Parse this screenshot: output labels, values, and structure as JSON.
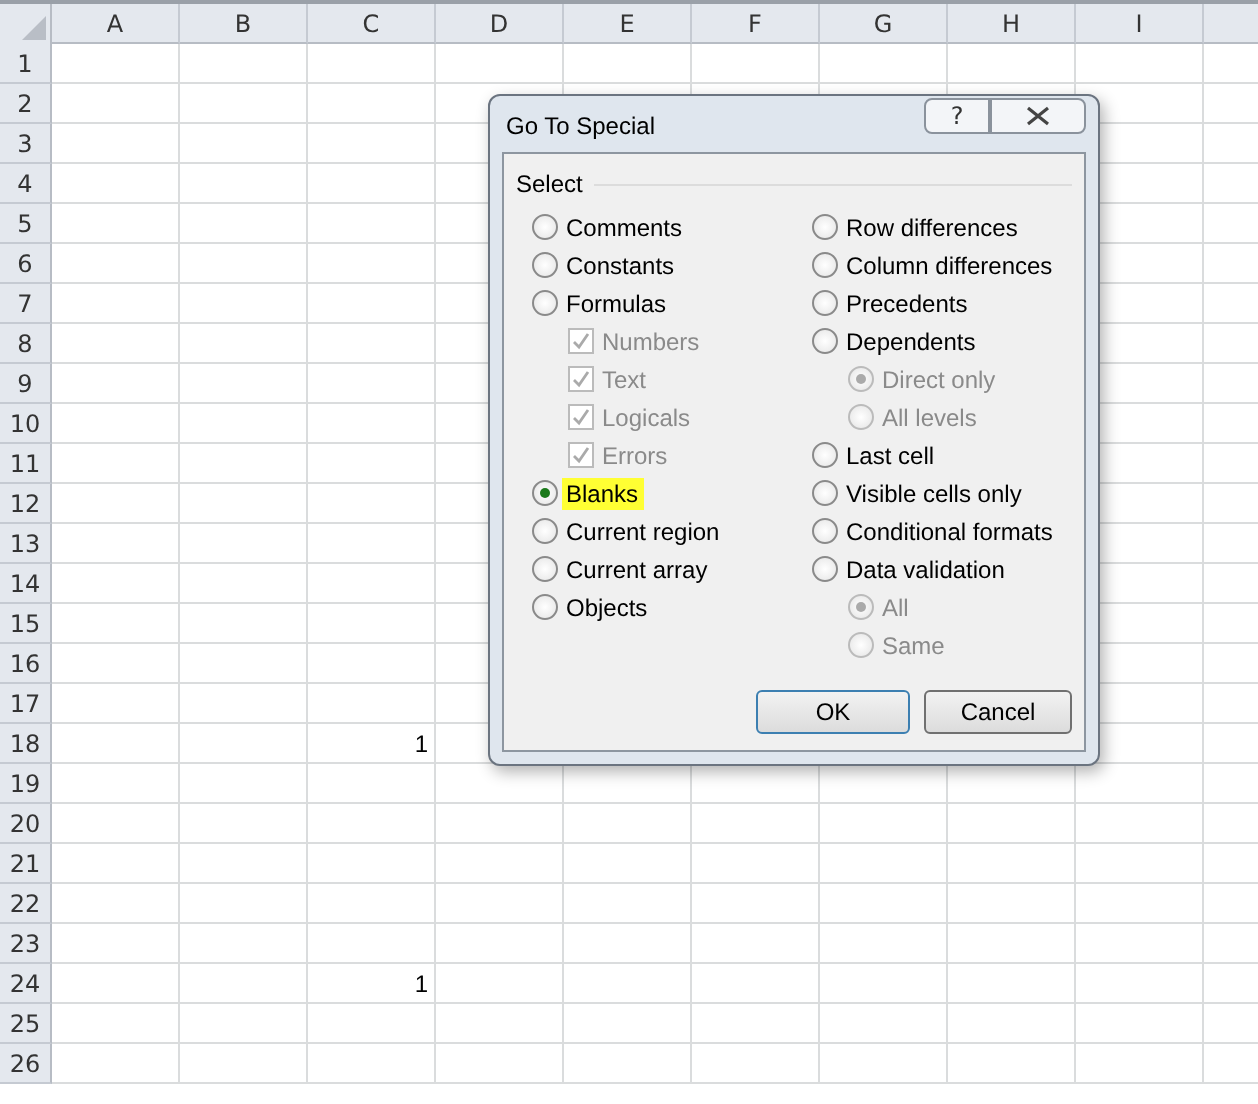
{
  "sheet": {
    "columns": [
      "A",
      "B",
      "C",
      "D",
      "E",
      "F",
      "G",
      "H",
      "I"
    ],
    "rows": [
      {
        "header": "1"
      },
      {
        "header": "2"
      },
      {
        "header": "3"
      },
      {
        "header": "4"
      },
      {
        "header": "5"
      },
      {
        "header": "6"
      },
      {
        "header": "7"
      },
      {
        "header": "8"
      },
      {
        "header": "9"
      },
      {
        "header": "10"
      },
      {
        "header": "11"
      },
      {
        "header": "12"
      },
      {
        "header": "13"
      },
      {
        "header": "14"
      },
      {
        "header": "15"
      },
      {
        "header": "16"
      },
      {
        "header": "17"
      },
      {
        "header": "18",
        "column_c": "1"
      },
      {
        "header": "19"
      },
      {
        "header": "20"
      },
      {
        "header": "21"
      },
      {
        "header": "22"
      },
      {
        "header": "23"
      },
      {
        "header": "24",
        "column_c": "1"
      },
      {
        "header": "25"
      },
      {
        "header": "26"
      }
    ]
  },
  "dialog": {
    "title": "Go To Special",
    "help": "?",
    "group_label": "Select",
    "left_options": [
      {
        "kind": "radio",
        "label": "Comments",
        "selected": false
      },
      {
        "kind": "radio",
        "label": "Constants",
        "selected": false
      },
      {
        "kind": "radio",
        "label": "Formulas",
        "selected": false,
        "children": [
          {
            "kind": "checkbox",
            "label": "Numbers",
            "checked": true,
            "disabled": true
          },
          {
            "kind": "checkbox",
            "label": "Text",
            "checked": true,
            "disabled": true
          },
          {
            "kind": "checkbox",
            "label": "Logicals",
            "checked": true,
            "disabled": true
          },
          {
            "kind": "checkbox",
            "label": "Errors",
            "checked": true,
            "disabled": true
          }
        ]
      },
      {
        "kind": "radio",
        "label": "Blanks",
        "selected": true,
        "highlighted": true
      },
      {
        "kind": "radio",
        "label": "Current region",
        "selected": false
      },
      {
        "kind": "radio",
        "label": "Current array",
        "selected": false
      },
      {
        "kind": "radio",
        "label": "Objects",
        "selected": false
      }
    ],
    "right_options": [
      {
        "kind": "radio",
        "label": "Row differences",
        "selected": false
      },
      {
        "kind": "radio",
        "label": "Column differences",
        "selected": false
      },
      {
        "kind": "radio",
        "label": "Precedents",
        "selected": false
      },
      {
        "kind": "radio",
        "label": "Dependents",
        "selected": false,
        "children": [
          {
            "kind": "radio",
            "label": "Direct only",
            "selected": true,
            "disabled": true
          },
          {
            "kind": "radio",
            "label": "All levels",
            "selected": false,
            "disabled": true
          }
        ]
      },
      {
        "kind": "radio",
        "label": "Last cell",
        "selected": false
      },
      {
        "kind": "radio",
        "label": "Visible cells only",
        "selected": false
      },
      {
        "kind": "radio",
        "label": "Conditional formats",
        "selected": false
      },
      {
        "kind": "radio",
        "label": "Data validation",
        "selected": false,
        "children": [
          {
            "kind": "radio",
            "label": "All",
            "selected": true,
            "disabled": true
          },
          {
            "kind": "radio",
            "label": "Same",
            "selected": false,
            "disabled": true
          }
        ]
      }
    ],
    "buttons": [
      {
        "label": "OK",
        "default": true
      },
      {
        "label": "Cancel",
        "default": false
      }
    ]
  }
}
